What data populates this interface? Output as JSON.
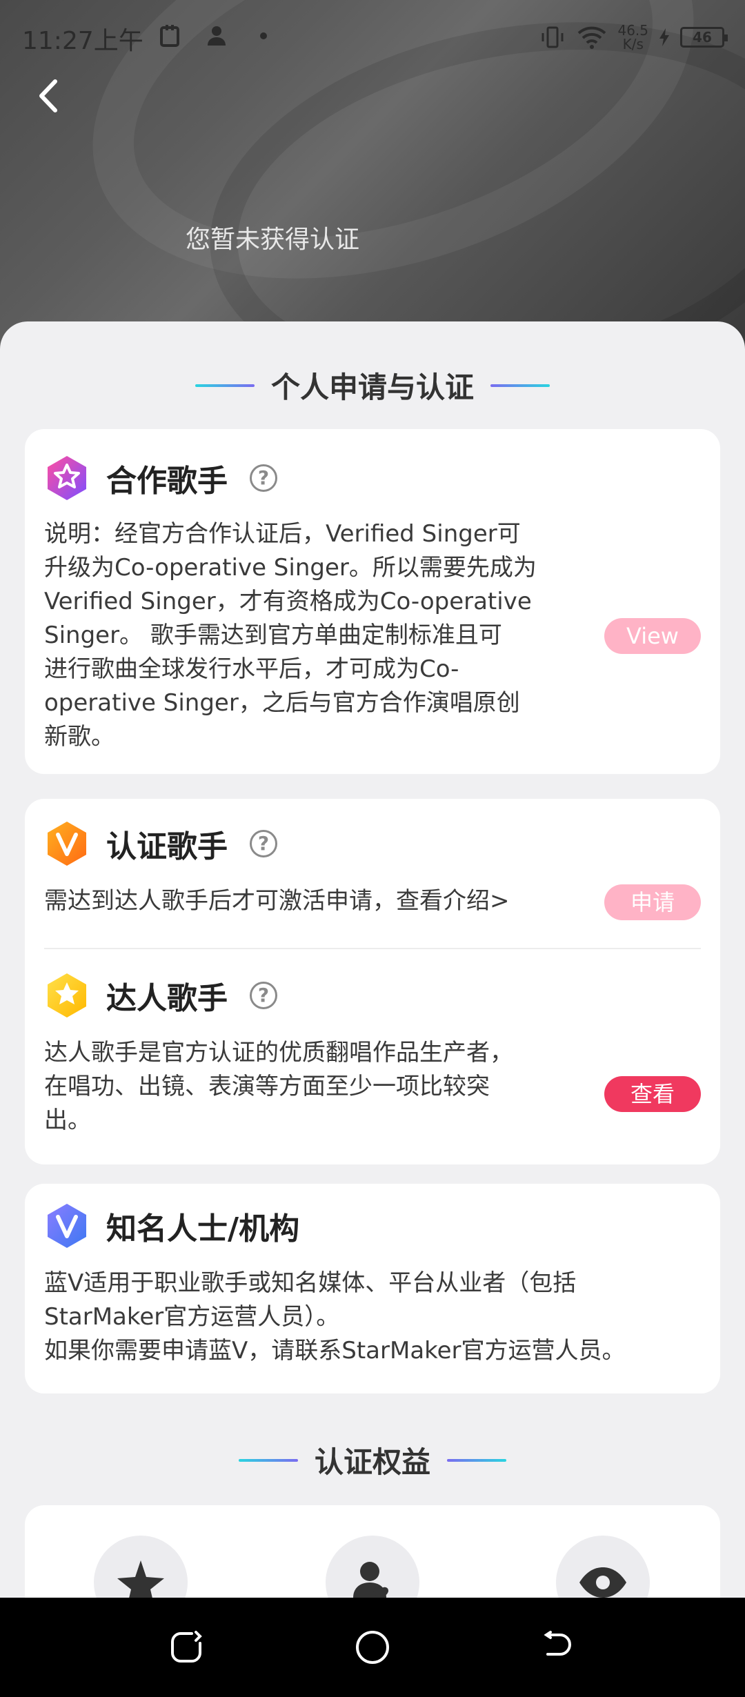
{
  "status_bar": {
    "time": "11:27上午",
    "net_speed_value": "46.5",
    "net_speed_unit": "K/s",
    "battery": "46"
  },
  "hero": {
    "message": "您暂未获得认证"
  },
  "sections": {
    "apply_title": "个人申请与认证",
    "benefits_title": "认证权益"
  },
  "cards": {
    "cooperative": {
      "title": "合作歌手",
      "help": "?",
      "desc_lines": [
        "说明：经官方合作认证后，Verified Singer可",
        "升级为Co-operative Singer。所以需要先成为",
        "Verified Singer，才有资格成为Co-operative",
        "Singer。 歌手需达到官方单曲定制标准且可",
        "进行歌曲全球发行水平后，才可成为Co-",
        "operative Singer，之后与官方合作演唱原创",
        "新歌。"
      ],
      "button": "View"
    },
    "verified": {
      "title": "认证歌手",
      "help": "?",
      "desc": "需达到达人歌手后才可激活申请，查看介绍>",
      "button": "申请"
    },
    "talent": {
      "title": "达人歌手",
      "help": "?",
      "desc_lines": [
        "达人歌手是官方认证的优质翻唱作品生产者，",
        "在唱功、出镜、表演等方面至少一项比较突",
        "出。"
      ],
      "button": "查看"
    },
    "celebrity": {
      "title": "知名人士/机构",
      "desc_lines": [
        "蓝V适用于职业歌手或知名媒体、平台从业者（包括",
        "StarMaker官方运营人员）。",
        "如果你需要申请蓝V，请联系StarMaker官方运营人员。"
      ]
    }
  },
  "colors": {
    "accent_pink": "#f0395f",
    "accent_pink_light": "#ffb3c6",
    "line_cyan": "#2ad4e0",
    "line_purple": "#7a6cf0"
  }
}
